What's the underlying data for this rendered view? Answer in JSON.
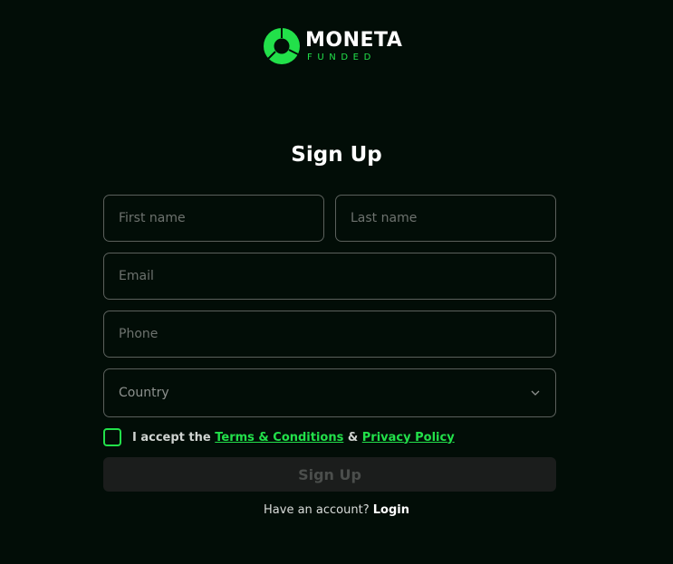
{
  "brand": {
    "name": "MONETA",
    "sub": "FUNDED",
    "accent": "#22e04a",
    "logo_icon": "moneta-ring-icon"
  },
  "form": {
    "title": "Sign Up",
    "first_name_placeholder": "First name",
    "last_name_placeholder": "Last name",
    "email_placeholder": "Email",
    "phone_placeholder": "Phone",
    "country_label": "Country",
    "country_icon": "chevron-down-icon",
    "terms_prefix": "I accept the",
    "terms_link": "Terms & Conditions",
    "terms_joiner": "&",
    "privacy_link": "Privacy Policy",
    "submit_label": "Sign Up"
  },
  "footer": {
    "prompt": "Have an account?",
    "login_link": "Login"
  }
}
